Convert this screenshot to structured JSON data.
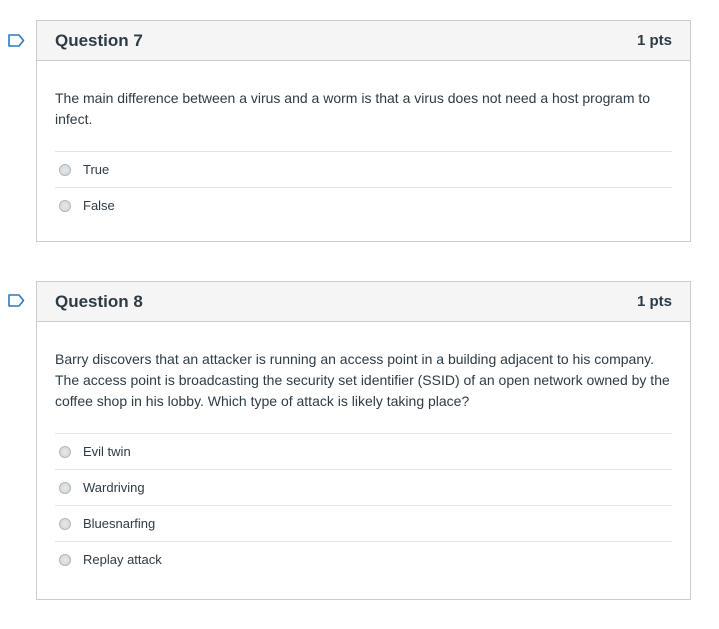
{
  "questions": [
    {
      "title": "Question 7",
      "points": "1 pts",
      "text": "The main difference between a virus and a worm is that a virus does not need a host program to infect.",
      "answers": [
        "True",
        "False"
      ]
    },
    {
      "title": "Question 8",
      "points": "1 pts",
      "text": "Barry discovers that an attacker is running an access point in a building adjacent to his company. The access point is broadcasting the security set identifier (SSID) of an open network owned by the coffee shop in his lobby. Which type of attack is likely taking place?",
      "answers": [
        "Evil twin",
        "Wardriving",
        "Bluesnarfing",
        "Replay attack"
      ]
    }
  ],
  "colors": {
    "flag": "#2b7abc",
    "header_bg": "#f5f5f5",
    "border": "#c7cdd1",
    "text": "#2d3b45"
  },
  "icons": {
    "flag": "flag-question-icon",
    "radio": "radio-button-icon"
  }
}
